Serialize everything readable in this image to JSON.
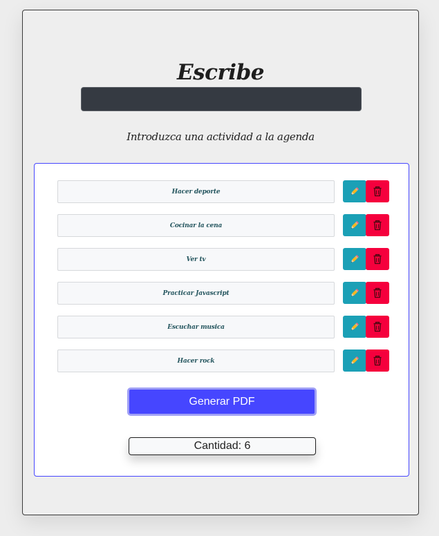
{
  "header": {
    "title": "Escribe",
    "instruction": "Introduzca una actividad a la agenda"
  },
  "input": {
    "value": "",
    "placeholder": ""
  },
  "tasks": [
    {
      "label": "Hacer deporte"
    },
    {
      "label": "Cocinar la cena"
    },
    {
      "label": "Ver tv"
    },
    {
      "label": "Practicar Javascript"
    },
    {
      "label": "Escuchar musica"
    },
    {
      "label": "Hacer rock"
    }
  ],
  "actions": {
    "edit_icon": "pencil-icon",
    "delete_icon": "trash-icon"
  },
  "pdf_button": {
    "label": "Generar PDF"
  },
  "counter": {
    "text": "Cantidad: 6"
  },
  "colors": {
    "accent": "#4646ff",
    "edit": "#1ba0b6",
    "delete": "#f5003d",
    "input_bg": "#353a42",
    "task_text": "#24555e"
  }
}
